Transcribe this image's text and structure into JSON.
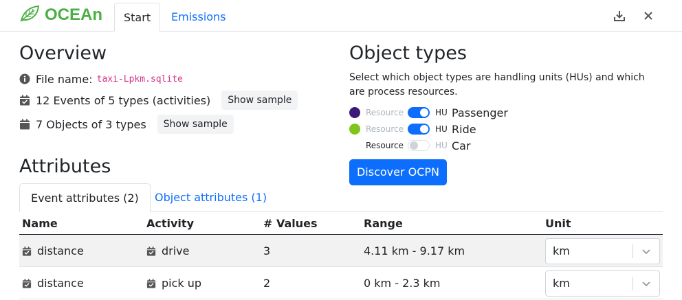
{
  "app": {
    "name": "OCEAn",
    "logo_icon": "leaf-icon",
    "brand_color": "#4bb043"
  },
  "nav": {
    "tabs": [
      {
        "label": "Start",
        "active": true
      },
      {
        "label": "Emissions",
        "active": false
      }
    ],
    "actions": [
      {
        "icon": "download-icon"
      },
      {
        "icon": "close-icon"
      }
    ]
  },
  "overview": {
    "title": "Overview",
    "file_label": "File name:",
    "file_name": "taxi-Lpkm.sqlite",
    "events_text": "12 Events of 5 types (activities)",
    "objects_text": "7 Objects of 3 types",
    "show_sample_label": "Show sample"
  },
  "object_types": {
    "title": "Object types",
    "description": "Select which object types are handling units (HUs) and which are process resources.",
    "resource_label": "Resource",
    "hu_label": "HU",
    "items": [
      {
        "name": "Passenger",
        "color": "#3b1a78",
        "is_hu": true
      },
      {
        "name": "Ride",
        "color": "#7ec51c",
        "is_hu": true
      },
      {
        "name": "Car",
        "color": "",
        "is_hu": false
      }
    ],
    "discover_label": "Discover OCPN"
  },
  "attributes": {
    "title": "Attributes",
    "tabs": [
      {
        "label": "Event attributes (2)",
        "active": true
      },
      {
        "label": "Object attributes (1)",
        "active": false
      }
    ],
    "columns": {
      "name": "Name",
      "activity": "Activity",
      "values": "# Values",
      "range": "Range",
      "unit": "Unit"
    },
    "rows": [
      {
        "name": "distance",
        "activity": "drive",
        "values": "3",
        "range": "4.11 km - 9.17 km",
        "unit": "km"
      },
      {
        "name": "distance",
        "activity": "pick up",
        "values": "2",
        "range": "0 km - 2.3 km",
        "unit": "km"
      }
    ]
  },
  "colors": {
    "accent": "#0d6efd",
    "border": "#dee2e6"
  }
}
